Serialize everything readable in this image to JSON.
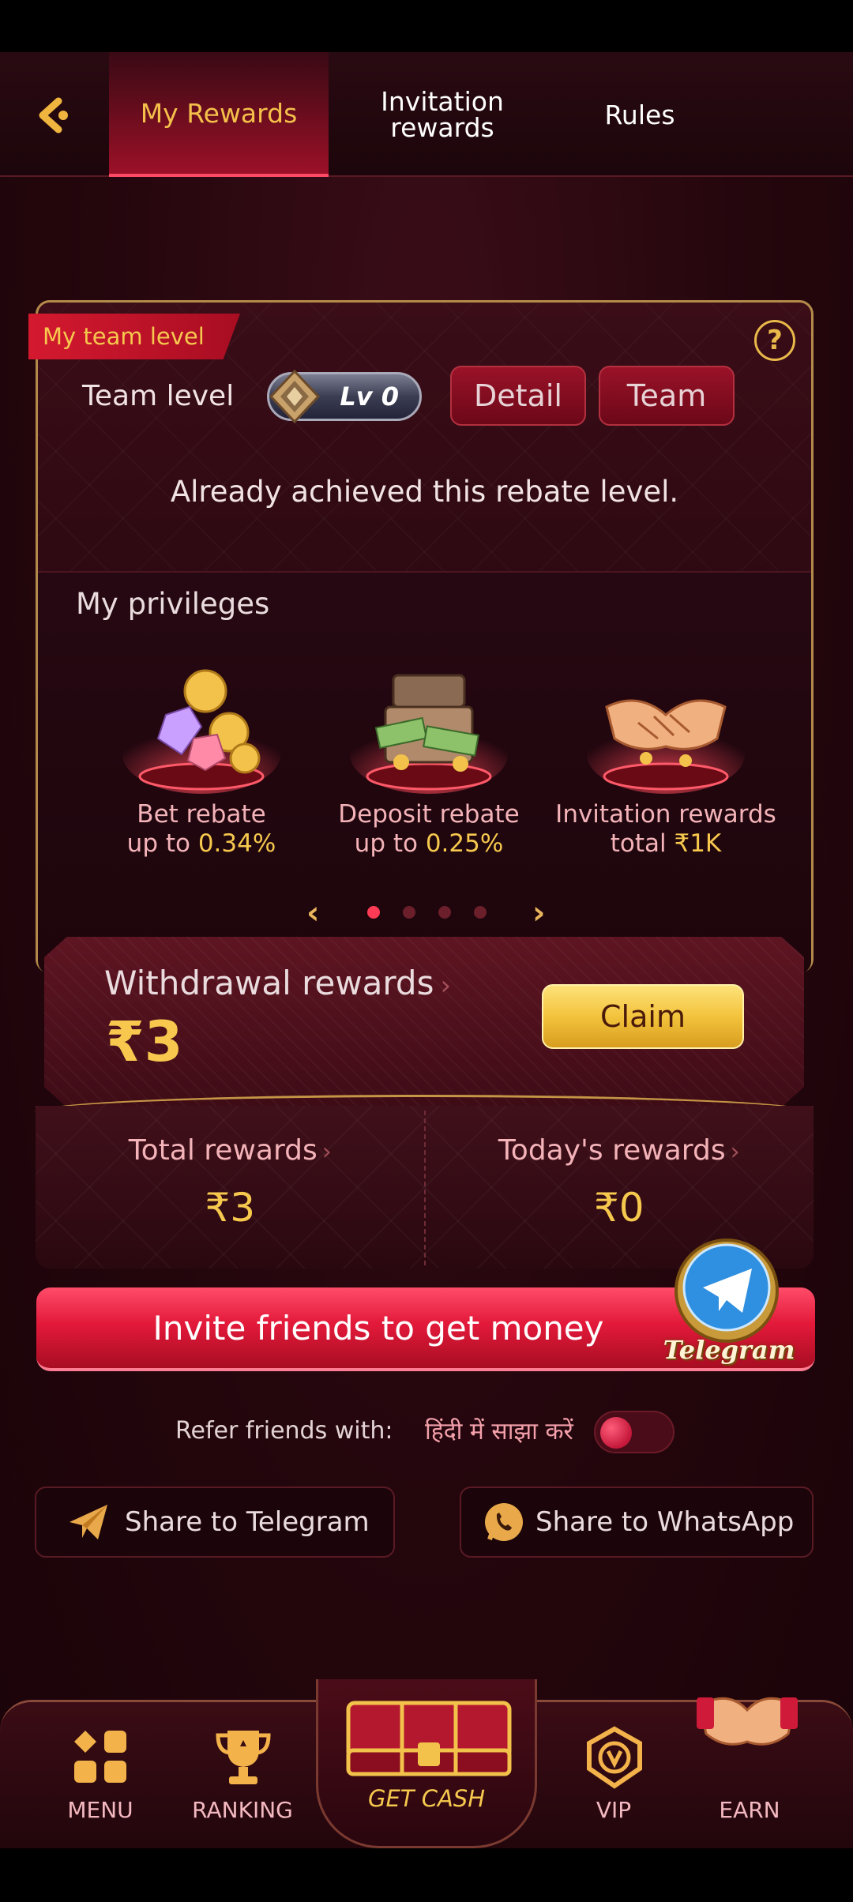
{
  "header": {
    "tabs": [
      {
        "label": "My Rewards",
        "active": true
      },
      {
        "label": "Invitation rewards",
        "active": false
      },
      {
        "label": "Rules",
        "active": false
      }
    ]
  },
  "team": {
    "badge": "My team level",
    "team_level_label": "Team level",
    "level": "Lv 0",
    "detail_button": "Detail",
    "team_button": "Team",
    "achieved_text": "Already achieved this rebate level."
  },
  "privileges": {
    "title": "My privileges",
    "items": [
      {
        "line1": "Bet rebate",
        "line2_prefix": "up to ",
        "line2_value": "0.34%"
      },
      {
        "line1": "Deposit rebate",
        "line2_prefix": "up to ",
        "line2_value": "0.25%"
      },
      {
        "line1": "Invitation rewards",
        "line2_prefix": "total ",
        "line2_value": "₹1K"
      }
    ],
    "page_count": 4,
    "current_page": 1
  },
  "withdrawal": {
    "label": "Withdrawal rewards",
    "amount": "₹3",
    "claim_button": "Claim"
  },
  "totals": {
    "total_label": "Total rewards",
    "total_value": "₹3",
    "today_label": "Today's rewards",
    "today_value": "₹0"
  },
  "invite": {
    "button": "Invite friends to get money",
    "telegram_badge": "Telegram"
  },
  "refer": {
    "label": "Refer friends with:",
    "hindi": "हिंदी में साझा करें",
    "toggle_on": false
  },
  "share": {
    "telegram": "Share to Telegram",
    "whatsapp": "Share to WhatsApp"
  },
  "bottom_nav": {
    "menu": "MENU",
    "ranking": "RANKING",
    "get_cash": "GET CASH",
    "vip": "VIP",
    "earn": "EARN"
  },
  "colors": {
    "accent_gold": "#f6c84e",
    "accent_red": "#e3193a",
    "bg_dark": "#24060d"
  }
}
